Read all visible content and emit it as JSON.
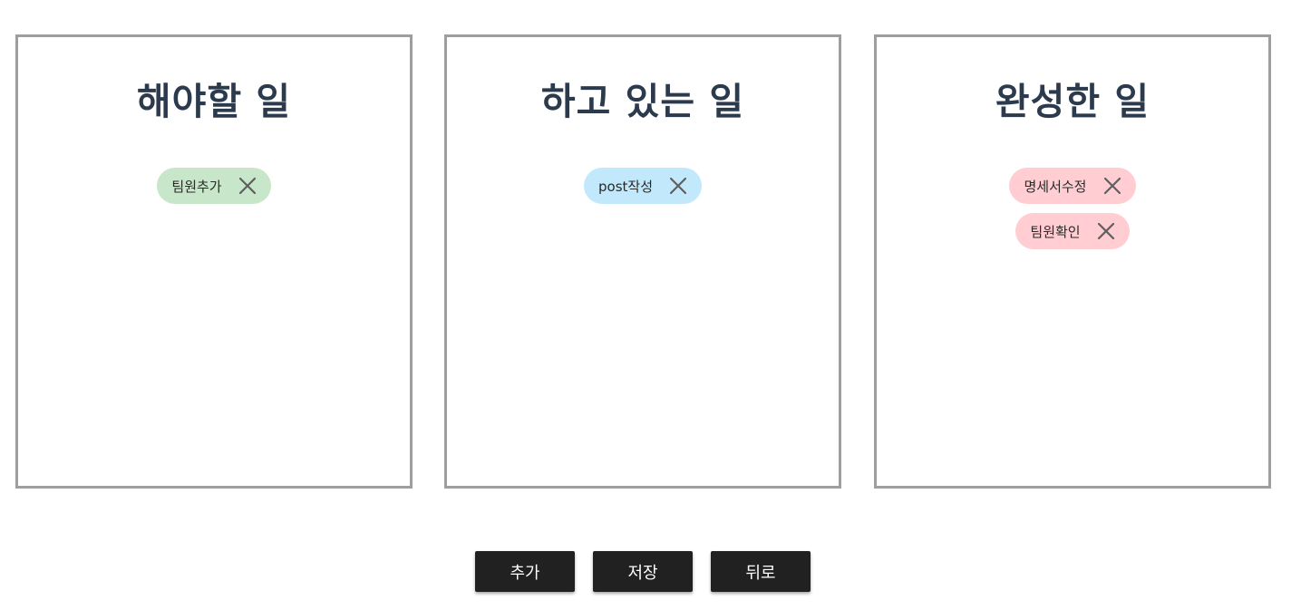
{
  "columns": [
    {
      "title": "해야할 일",
      "chip_color": "#c8e6c9",
      "items": [
        {
          "label": "팀원추가",
          "remove_icon": "close-icon"
        }
      ]
    },
    {
      "title": "하고 있는 일",
      "chip_color": "#c2e9fb",
      "items": [
        {
          "label": "post작성",
          "remove_icon": "close-icon"
        }
      ]
    },
    {
      "title": "완성한 일",
      "chip_color": "#ffcdd2",
      "items": [
        {
          "label": "명세서수정",
          "remove_icon": "close-icon"
        },
        {
          "label": "팀원확인",
          "remove_icon": "close-icon"
        }
      ]
    }
  ],
  "actions": {
    "add_label": "추가",
    "save_label": "저장",
    "back_label": "뒤로"
  },
  "colors": {
    "title": "#2b3a4d",
    "border": "#9e9e9e",
    "button_bg": "#212121",
    "close_icon": "#5f5f5f"
  }
}
